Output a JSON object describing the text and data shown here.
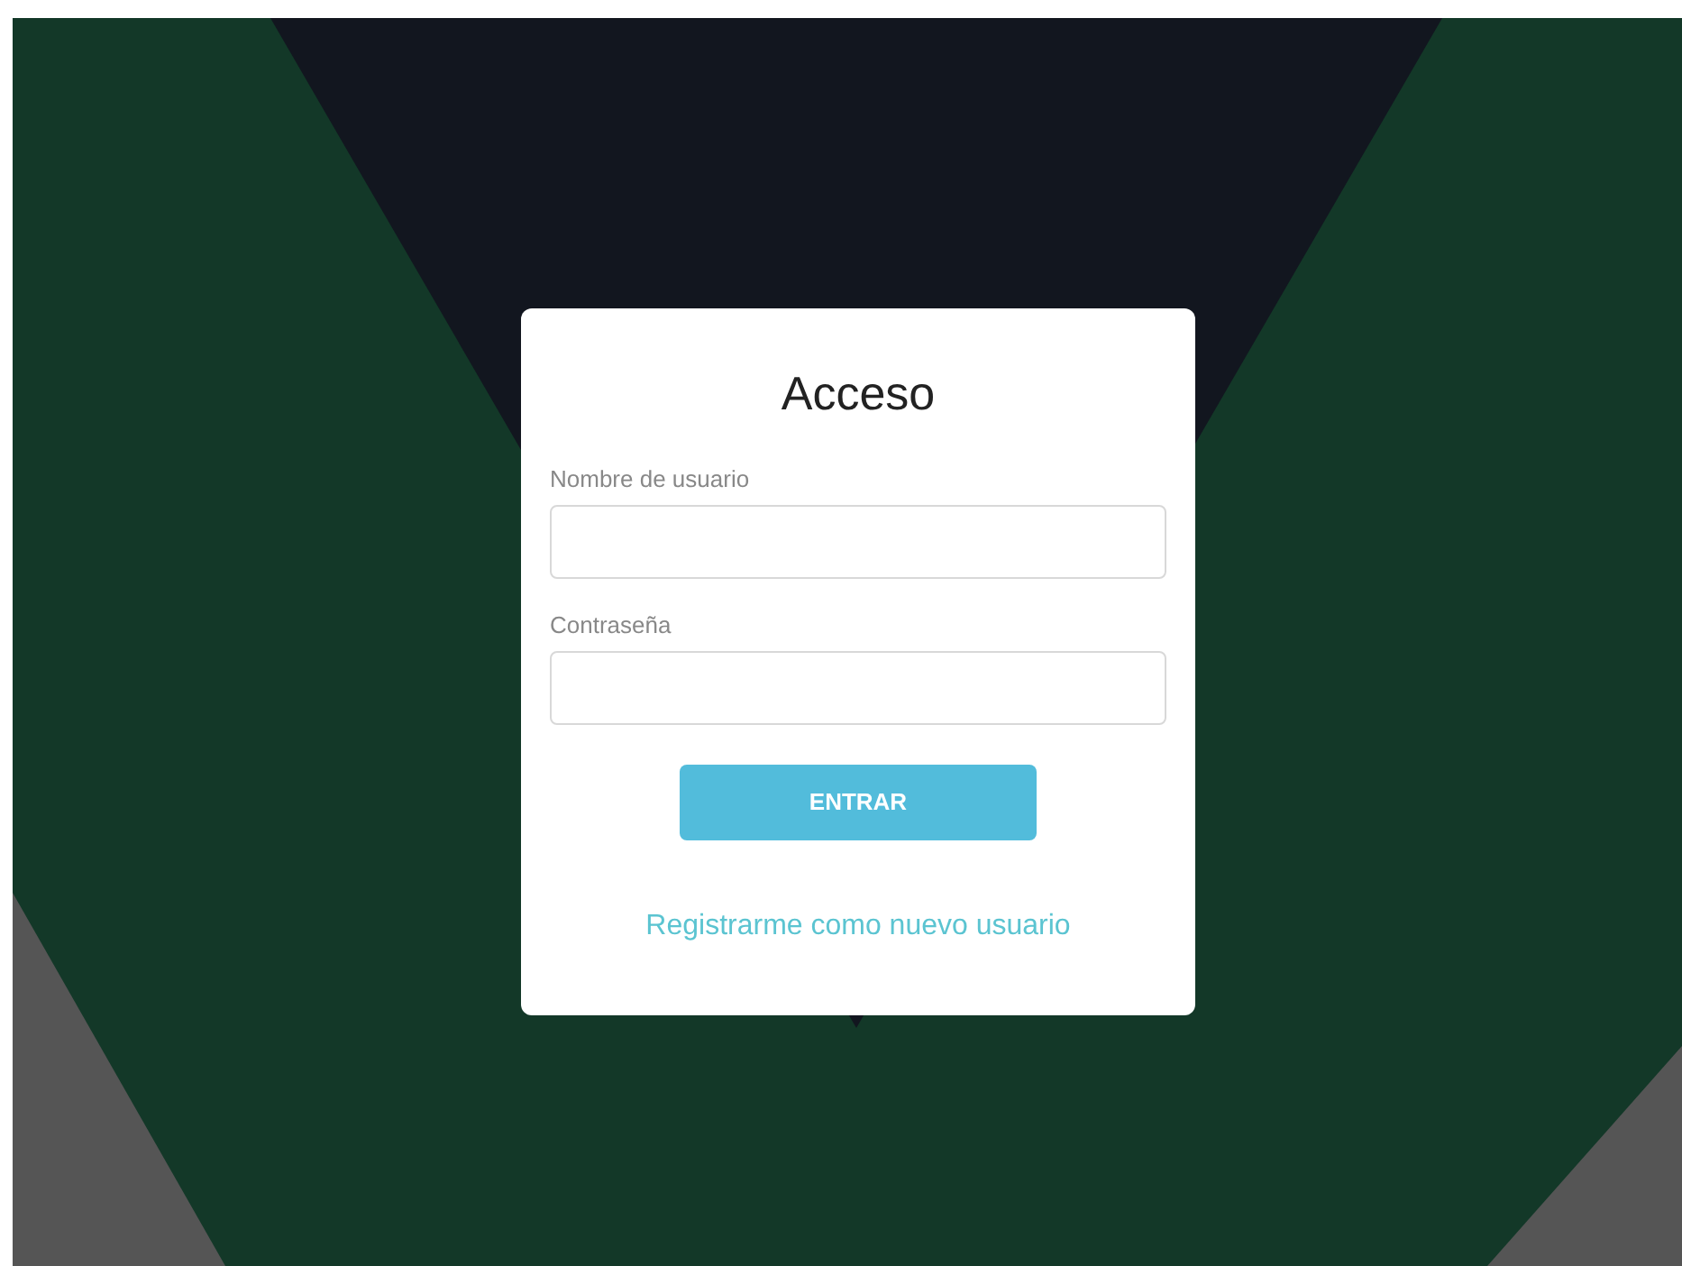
{
  "login": {
    "title": "Acceso",
    "fields": [
      {
        "label": "Nombre de usuario"
      },
      {
        "label": "Contraseña"
      }
    ],
    "submit_button": "ENTRAR",
    "register_link": "Registrarme como nuevo usuario"
  }
}
